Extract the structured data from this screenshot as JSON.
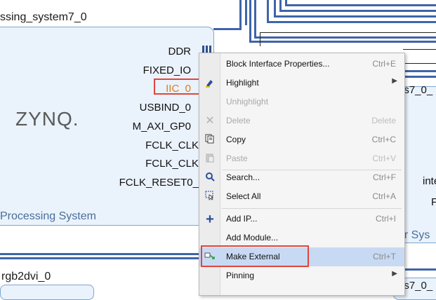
{
  "zynq_block": {
    "title": "ssing_system7_0",
    "logo_text": "ZYNQ.",
    "subtitle": "Processing System",
    "ports": [
      "DDR",
      "FIXED_IO",
      "IIC_0",
      "USBIND_0",
      "M_AXI_GP0",
      "FCLK_CLK",
      "FCLK_CLK",
      "FCLK_RESET0_"
    ]
  },
  "right_block": {
    "title": "ps7_0_",
    "port1": "inte",
    "port2": "F",
    "subtitle": "or Sys"
  },
  "rgb_block": {
    "title": "rgb2dvi_0"
  },
  "right_block2": {
    "title": "ps7_0_"
  },
  "context_menu": {
    "items": [
      {
        "label": "Block Interface Properties...",
        "shortcut": "Ctrl+E",
        "icon": "none"
      },
      {
        "label": "Highlight",
        "shortcut": "",
        "icon": "highlight-icon",
        "submenu": true
      },
      {
        "label": "Unhighlight",
        "shortcut": "",
        "icon": "none",
        "disabled": true
      },
      {
        "label": "Delete",
        "shortcut": "Delete",
        "icon": "delete-icon",
        "disabled": true
      },
      {
        "label": "Copy",
        "shortcut": "Ctrl+C",
        "icon": "copy-icon"
      },
      {
        "label": "Paste",
        "shortcut": "Ctrl+V",
        "icon": "paste-icon",
        "disabled": true
      },
      {
        "label": "Search...",
        "shortcut": "Ctrl+F",
        "icon": "search-icon"
      },
      {
        "label": "Select All",
        "shortcut": "Ctrl+A",
        "icon": "select-all-icon"
      },
      {
        "label": "Add IP...",
        "shortcut": "Ctrl+I",
        "icon": "add-icon"
      },
      {
        "label": "Add Module...",
        "shortcut": "",
        "icon": "none"
      },
      {
        "label": "Make External",
        "shortcut": "Ctrl+T",
        "icon": "make-external-icon",
        "selected": true
      },
      {
        "label": "Pinning",
        "shortcut": "",
        "icon": "none",
        "submenu": true
      }
    ]
  },
  "colors": {
    "highlight_box": "#e0463c",
    "iic_label": "#e07a1f",
    "bus": "#3f64a8",
    "selected_row": "#c8daf3"
  }
}
